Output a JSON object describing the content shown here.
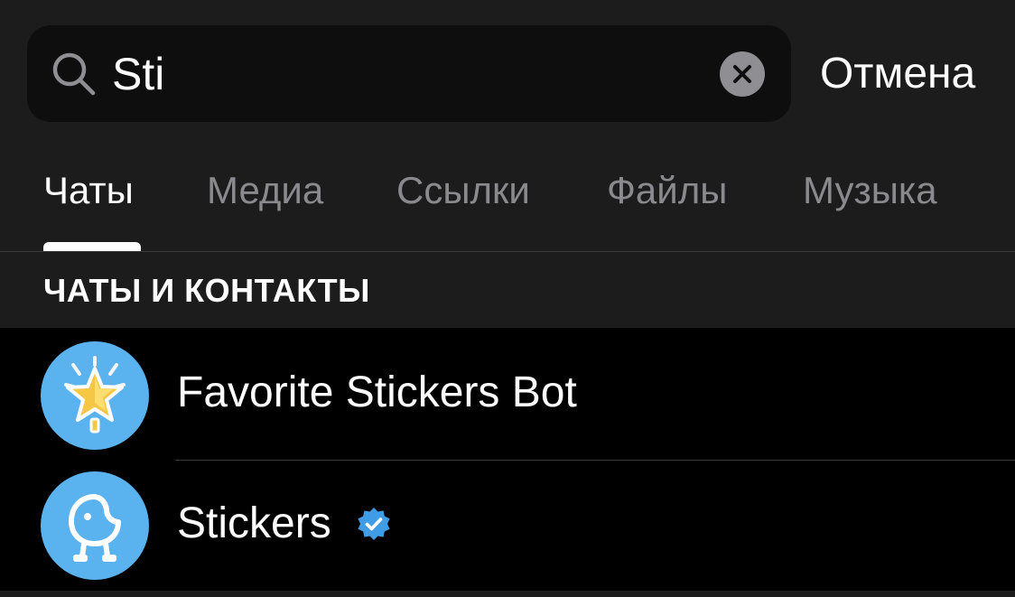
{
  "search": {
    "value": "Sti",
    "cancel_label": "Отмена"
  },
  "tabs": [
    {
      "label": "Чаты",
      "active": true
    },
    {
      "label": "Медиа",
      "active": false
    },
    {
      "label": "Ссылки",
      "active": false
    },
    {
      "label": "Файлы",
      "active": false
    },
    {
      "label": "Музыка",
      "active": false
    }
  ],
  "section": {
    "title": "ЧАТЫ И КОНТАКТЫ"
  },
  "results": [
    {
      "name": "Favorite Stickers Bot",
      "avatar_icon": "star-icon",
      "verified": false
    },
    {
      "name": "Stickers",
      "avatar_icon": "sticker-mascot-icon",
      "verified": true
    }
  ],
  "colors": {
    "header_bg": "#1c1c1d",
    "search_bg": "#0e0e0e",
    "inactive_tab": "#8a8a8e",
    "avatar_blue": "#5ab2ee",
    "verified_blue": "#3f9de8"
  }
}
